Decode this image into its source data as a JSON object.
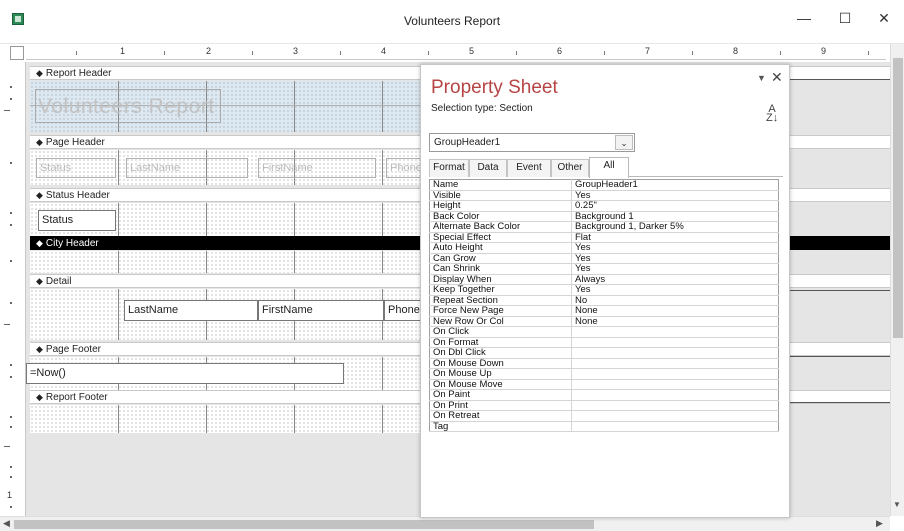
{
  "window": {
    "title": "Volunteers Report",
    "min_glyph": "—",
    "max_glyph": "☐",
    "close_glyph": "✕"
  },
  "ruler": {
    "numbers": [
      "1",
      "2",
      "3",
      "4",
      "5",
      "6",
      "7",
      "8",
      "9"
    ],
    "left_number": "1"
  },
  "sections": {
    "report_header": "Report Header",
    "page_header": "Page Header",
    "status_header": "Status Header",
    "city_header": "City Header",
    "detail": "Detail",
    "page_footer": "Page Footer",
    "report_footer": "Report Footer",
    "arrow": "◆"
  },
  "controls": {
    "report_title": "Volunteers Report",
    "ph_status": "Status",
    "ph_lastname": "LastName",
    "ph_firstname": "FirstName",
    "ph_phone": "Phone",
    "sh_status": "Status",
    "d_lastname": "LastName",
    "d_firstname": "FirstName",
    "d_phone": "Phone",
    "pf_now": "=Now()"
  },
  "property_sheet": {
    "title": "Property Sheet",
    "selection_type": "Selection type:  Section",
    "selected_object": "GroupHeader1",
    "tabs": [
      "Format",
      "Data",
      "Event",
      "Other",
      "All"
    ],
    "active_tab": "All",
    "properties": [
      {
        "name": "Name",
        "value": "GroupHeader1"
      },
      {
        "name": "Visible",
        "value": "Yes"
      },
      {
        "name": "Height",
        "value": "0.25\""
      },
      {
        "name": "Back Color",
        "value": "Background 1"
      },
      {
        "name": "Alternate Back Color",
        "value": "Background 1, Darker 5%"
      },
      {
        "name": "Special Effect",
        "value": "Flat"
      },
      {
        "name": "Auto Height",
        "value": "Yes"
      },
      {
        "name": "Can Grow",
        "value": "Yes"
      },
      {
        "name": "Can Shrink",
        "value": "Yes"
      },
      {
        "name": "Display When",
        "value": "Always"
      },
      {
        "name": "Keep Together",
        "value": "Yes"
      },
      {
        "name": "Repeat Section",
        "value": "No"
      },
      {
        "name": "Force New Page",
        "value": "None"
      },
      {
        "name": "New Row Or Col",
        "value": "None"
      },
      {
        "name": "On Click",
        "value": ""
      },
      {
        "name": "On Format",
        "value": ""
      },
      {
        "name": "On Dbl Click",
        "value": ""
      },
      {
        "name": "On Mouse Down",
        "value": ""
      },
      {
        "name": "On Mouse Up",
        "value": ""
      },
      {
        "name": "On Mouse Move",
        "value": ""
      },
      {
        "name": "On Paint",
        "value": ""
      },
      {
        "name": "On Print",
        "value": ""
      },
      {
        "name": "On Retreat",
        "value": ""
      },
      {
        "name": "Tag",
        "value": ""
      }
    ]
  },
  "colors": {
    "accent_title": "#b74444",
    "selected_section_bar": "#000000"
  }
}
